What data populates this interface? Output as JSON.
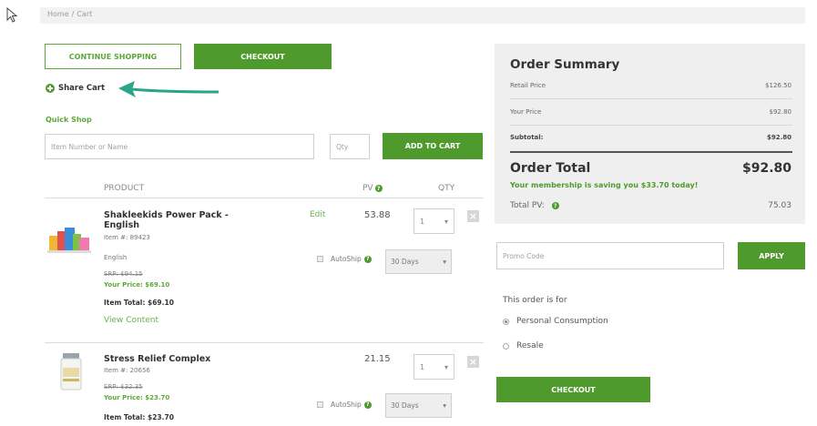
{
  "breadcrumb": {
    "home": "Home",
    "sep": "/",
    "current": "Cart"
  },
  "actions": {
    "continue_label": "CONTINUE SHOPPING",
    "checkout_label": "CHECKOUT",
    "share_cart_label": "Share Cart"
  },
  "quick_shop": {
    "title": "Quick Shop",
    "item_placeholder": "Item Number or Name",
    "qty_placeholder": "Qty",
    "add_label": "ADD TO CART"
  },
  "cart_headers": {
    "product": "PRODUCT",
    "pv": "PV",
    "qty": "QTY"
  },
  "items": [
    {
      "name": "Shakleekids Power Pack - English",
      "item_no": "Item #: 89423",
      "variant": "English",
      "edit_label": "Edit",
      "pv": "53.88",
      "qty": "1",
      "srp": "SRP: $94.15",
      "your_price": "Your Price: $69.10",
      "item_total": "Item Total: $69.10",
      "view_content": "View Content",
      "autoship_label": "AutoShip",
      "autoship_interval": "30 Days"
    },
    {
      "name": "Stress Relief Complex",
      "item_no": "Item #: 20656",
      "pv": "21.15",
      "qty": "1",
      "srp": "SRP: $32.35",
      "your_price": "Your Price: $23.70",
      "item_total": "Item Total: $23.70",
      "autoship_label": "AutoShip",
      "autoship_interval": "30 Days"
    }
  ],
  "summary": {
    "title": "Order Summary",
    "retail_label": "Retail Price",
    "retail_value": "$126.50",
    "your_label": "Your Price",
    "your_value": "$92.80",
    "subtotal_label": "Subtotal:",
    "subtotal_value": "$92.80",
    "total_label": "Order Total",
    "total_value": "$92.80",
    "saving_text": "Your membership is saving you  $33.70  today!",
    "total_pv_label": "Total PV:",
    "total_pv_value": "75.03"
  },
  "promo": {
    "placeholder": "Promo Code",
    "apply_label": "APPLY"
  },
  "order_for": {
    "label": "This order is for",
    "options": [
      "Personal Consumption",
      "Resale"
    ],
    "selected": "Personal Consumption"
  },
  "colors": {
    "brand_green": "#4f9a2d",
    "link_green": "#6ab04c",
    "summary_bg": "#efefef",
    "arrow_teal": "#2aa58a"
  }
}
